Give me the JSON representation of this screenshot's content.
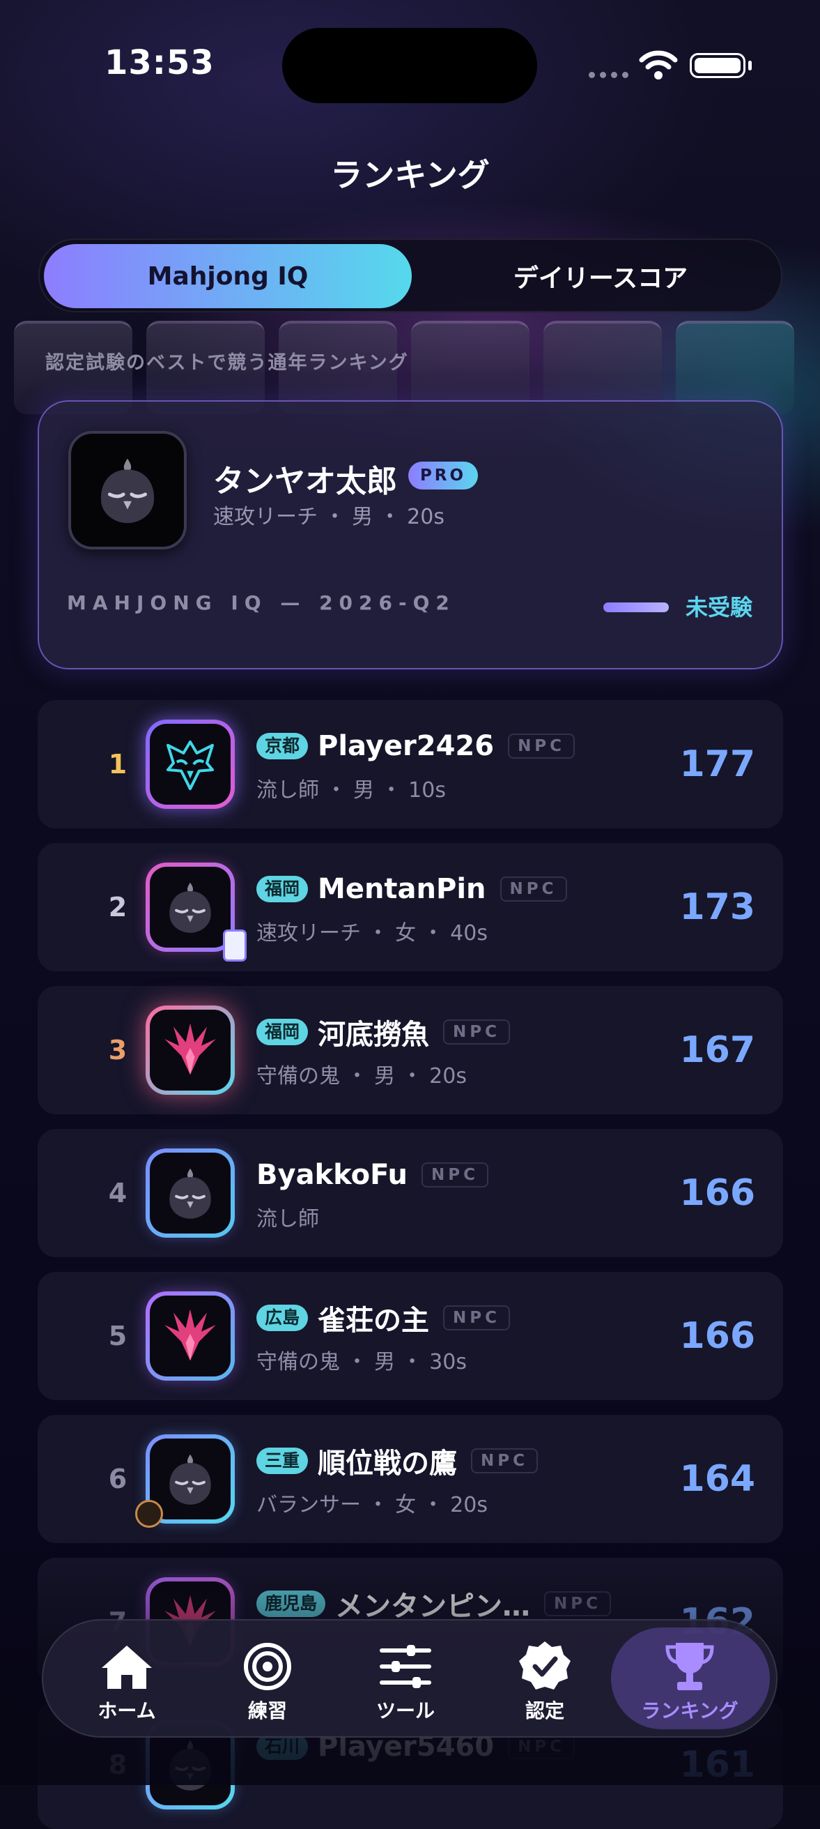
{
  "status_bar": {
    "time": "13:53"
  },
  "header": {
    "title": "ランキング"
  },
  "tabs": [
    {
      "label": "Mahjong IQ",
      "active": true
    },
    {
      "label": "デイリースコア",
      "active": false
    }
  ],
  "subtitle": "認定試験のベストで競う通年ランキング",
  "profile": {
    "name": "タンヤオ太郎",
    "badge": "PRO",
    "meta": "速攻リーチ ・ 男 ・ 20s",
    "iq_label": "MAHJONG IQ — 2026-Q2",
    "iq_status": "未受験"
  },
  "ranking": [
    {
      "rank": "1",
      "region": "京都",
      "name": "Player2426",
      "npc": "NPC",
      "meta": "流し師 ・ 男 ・ 10s",
      "score": "177",
      "rank_color": "#f1c35a",
      "avatar_icon": "owl-icon"
    },
    {
      "rank": "2",
      "region": "福岡",
      "name": "MentanPin",
      "npc": "NPC",
      "meta": "速攻リーチ ・ 女 ・ 40s",
      "score": "173",
      "rank_color": "#c9c7d8",
      "avatar_icon": "bird-icon"
    },
    {
      "rank": "3",
      "region": "福岡",
      "name": "河底撈魚",
      "npc": "NPC",
      "meta": "守備の鬼 ・ 男 ・ 20s",
      "score": "167",
      "rank_color": "#e9a06a",
      "avatar_icon": "phoenix-icon"
    },
    {
      "rank": "4",
      "region": "",
      "name": "ByakkoFu",
      "npc": "NPC",
      "meta": "流し師",
      "score": "166",
      "rank_color": "#8c8aa3",
      "avatar_icon": "bird-icon"
    },
    {
      "rank": "5",
      "region": "広島",
      "name": "雀荘の主",
      "npc": "NPC",
      "meta": "守備の鬼 ・ 男 ・ 30s",
      "score": "166",
      "rank_color": "#8c8aa3",
      "avatar_icon": "phoenix-icon"
    },
    {
      "rank": "6",
      "region": "三重",
      "name": "順位戦の鷹",
      "npc": "NPC",
      "meta": "バランサー ・ 女 ・ 20s",
      "score": "164",
      "rank_color": "#8c8aa3",
      "avatar_icon": "bird-icon"
    },
    {
      "rank": "7",
      "region": "鹿児島",
      "name": "メンタンピン…",
      "npc": "NPC",
      "meta": "",
      "score": "162",
      "rank_color": "#8c8aa3",
      "avatar_icon": "phoenix-icon"
    },
    {
      "rank": "8",
      "region": "石川",
      "name": "Player5460",
      "npc": "NPC",
      "meta": "",
      "score": "161",
      "rank_color": "#8c8aa3",
      "avatar_icon": "bird-icon"
    }
  ],
  "tab_bar": [
    {
      "label": "ホーム",
      "icon": "home-icon"
    },
    {
      "label": "練習",
      "icon": "target-icon"
    },
    {
      "label": "ツール",
      "icon": "sliders-icon"
    },
    {
      "label": "認定",
      "icon": "verified-badge-icon"
    },
    {
      "label": "ランキング",
      "icon": "trophy-icon",
      "active": true
    }
  ],
  "colors": {
    "accent_purple": "#8d7dff",
    "accent_cyan": "#55d9ec",
    "score_blue": "#7ba8ff"
  }
}
